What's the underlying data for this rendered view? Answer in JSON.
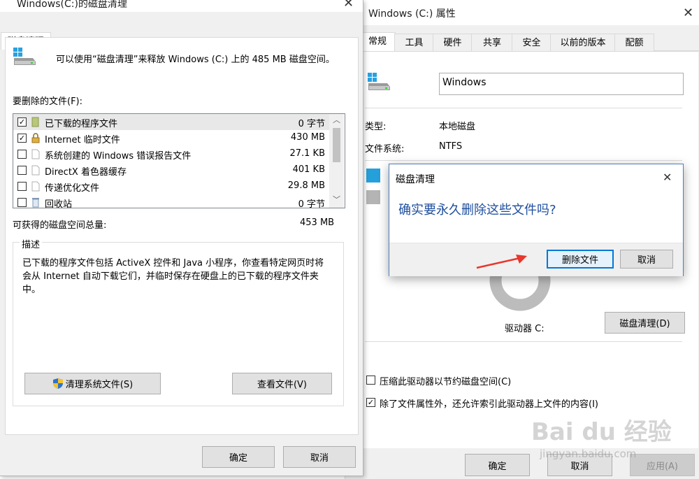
{
  "properties": {
    "title": "Windows (C:) 属性",
    "tabs": [
      "常规",
      "工具",
      "硬件",
      "共享",
      "安全",
      "以前的版本",
      "配额"
    ],
    "drive_name_value": "Windows",
    "type_label": "类型:",
    "type_value": "本地磁盘",
    "fs_label": "文件系统:",
    "fs_value": "NTFS",
    "drive_label": "驱动器 C:",
    "cleanup_button": "磁盘清理(D)",
    "compress_label": "压缩此驱动器以节约磁盘空间(C)",
    "compress_checked": false,
    "index_label": "除了文件属性外，还允许索引此驱动器上文件的内容(I)",
    "index_checked": true,
    "ok": "确定",
    "cancel": "取消",
    "apply": "应用(A)",
    "used_color": "#26a0da",
    "free_color": "#bcbcbc"
  },
  "cleanup": {
    "title": "Windows(C:)的磁盘清理",
    "tab": "磁盘清理",
    "intro": "可以使用“磁盘清理”来释放 Windows (C:) 上的 485 MB 磁盘空间。",
    "files_label": "要删除的文件(F):",
    "files": [
      {
        "name": "已下载的程序文件",
        "size": "0 字节",
        "checked": true,
        "icon": "folder-icon"
      },
      {
        "name": "Internet 临时文件",
        "size": "430 MB",
        "checked": true,
        "icon": "lock-icon"
      },
      {
        "name": "系统创建的 Windows 错误报告文件",
        "size": "27.1 KB",
        "checked": false,
        "icon": "file-icon"
      },
      {
        "name": "DirectX 着色器缓存",
        "size": "401 KB",
        "checked": false,
        "icon": "file-icon"
      },
      {
        "name": "传递优化文件",
        "size": "29.8 MB",
        "checked": false,
        "icon": "file-icon"
      },
      {
        "name": "回收站",
        "size": "0 字节",
        "checked": false,
        "icon": "recycle-bin-icon"
      }
    ],
    "total_label": "可获得的磁盘空间总量:",
    "total_value": "453 MB",
    "desc_label": "描述",
    "desc_text": "已下载的程序文件包括 ActiveX 控件和 Java 小程序，你查看特定网页时将会从 Internet 自动下载它们，并临时保存在硬盘上的已下载的程序文件夹中。",
    "clean_system_button": "清理系统文件(S)",
    "view_files_button": "查看文件(V)",
    "ok": "确定",
    "cancel": "取消"
  },
  "confirm": {
    "title": "磁盘清理",
    "message": "确实要永久删除这些文件吗?",
    "delete_button": "删除文件",
    "cancel_button": "取消",
    "message_color": "#1e4e9e",
    "arrow_color": "#e8372c"
  },
  "watermark": {
    "brand": "Bai du 经验",
    "url": "jingyan.baidu.com"
  }
}
